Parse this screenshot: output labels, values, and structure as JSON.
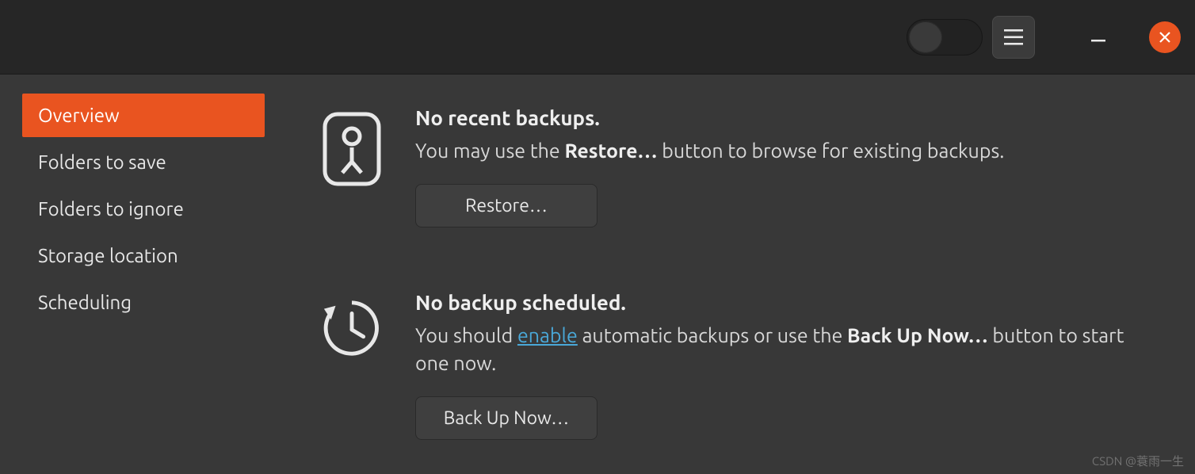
{
  "sidebar": {
    "items": [
      {
        "label": "Overview",
        "active": true
      },
      {
        "label": "Folders to save",
        "active": false
      },
      {
        "label": "Folders to ignore",
        "active": false
      },
      {
        "label": "Storage location",
        "active": false
      },
      {
        "label": "Scheduling",
        "active": false
      }
    ]
  },
  "titlebar": {
    "auto_backup_toggle": false
  },
  "overview": {
    "restore_section": {
      "heading": "No recent backups.",
      "desc_prefix": "You may use the ",
      "desc_bold": "Restore…",
      "desc_suffix": " button to browse for existing backups.",
      "button": "Restore…"
    },
    "schedule_section": {
      "heading": "No backup scheduled.",
      "desc_prefix": "You should ",
      "desc_link": "enable",
      "desc_mid": " automatic backups or use the ",
      "desc_bold": "Back Up Now…",
      "desc_suffix": " button to start one now.",
      "button": "Back Up Now…"
    }
  },
  "watermark": "CSDN @蓑雨一生"
}
